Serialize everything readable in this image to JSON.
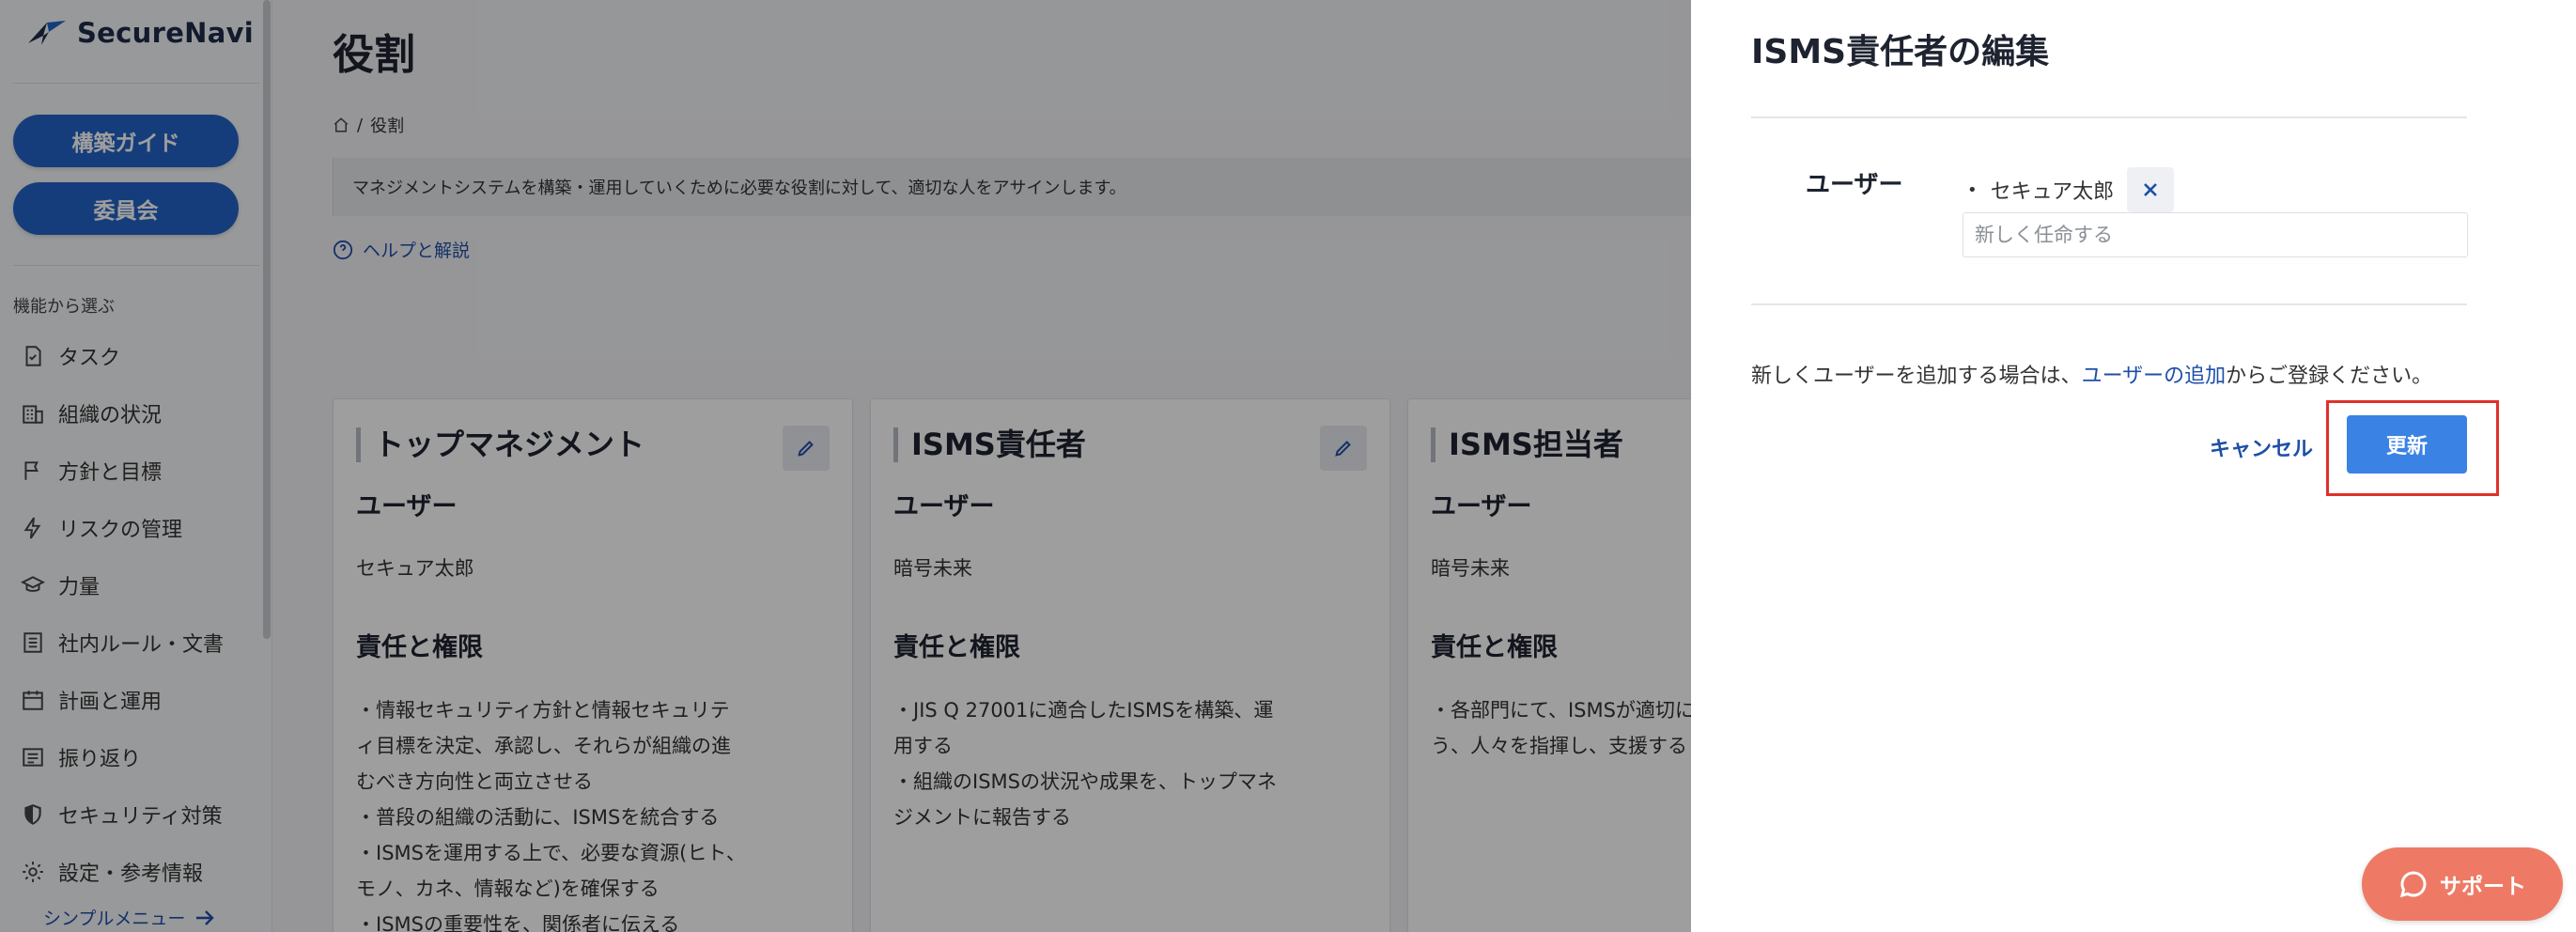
{
  "brand": {
    "name": "SecureNavi"
  },
  "sidebar": {
    "buttons": [
      "構築ガイド",
      "委員会"
    ],
    "section_label": "機能から選ぶ",
    "items": [
      {
        "label": "タスク",
        "icon": "task-icon"
      },
      {
        "label": "組織の状況",
        "icon": "building-icon"
      },
      {
        "label": "方針と目標",
        "icon": "flag-icon"
      },
      {
        "label": "リスクの管理",
        "icon": "bolt-icon"
      },
      {
        "label": "力量",
        "icon": "graduation-cap-icon"
      },
      {
        "label": "社内ルール・文書",
        "icon": "document-icon"
      },
      {
        "label": "計画と運用",
        "icon": "calendar-icon"
      },
      {
        "label": "振り返り",
        "icon": "list-icon"
      },
      {
        "label": "セキュリティ対策",
        "icon": "shield-icon"
      },
      {
        "label": "設定・参考情報",
        "icon": "gear-icon"
      }
    ],
    "simple_menu": "シンプルメニュー"
  },
  "page": {
    "title": "役割",
    "breadcrumb_current": "役割",
    "description": "マネジメントシステムを構築・運用していくために必要な役割に対して、適切な人をアサインします。",
    "help_link": "ヘルプと解説"
  },
  "cards": [
    {
      "title": "トップマネジメント",
      "user_heading": "ユーザー",
      "user": "セキュア太郎",
      "resp_heading": "責任と権限",
      "lines": [
        "・情報セキュリティ方針と情報セキュリテ",
        "ィ目標を決定、承認し、それらが組織の進",
        "むべき方向性と両立させる",
        "・普段の組織の活動に、ISMSを統合する",
        "・ISMSを運用する上で、必要な資源(ヒト、",
        "モノ、カネ、情報など)を確保する",
        "・ISMSの重要性を、関係者に伝える"
      ]
    },
    {
      "title": "ISMS責任者",
      "user_heading": "ユーザー",
      "user": "暗号未来",
      "resp_heading": "責任と権限",
      "lines": [
        "・JIS Q 27001に適合したISMSを構築、運",
        "用する",
        "・組織のISMSの状況や成果を、トップマネ",
        "ジメントに報告する"
      ]
    },
    {
      "title": "ISMS担当者",
      "user_heading": "ユーザー",
      "user": "暗号未来",
      "resp_heading": "責任と権限",
      "lines": [
        "・各部門にて、ISMSが適切に",
        "う、人々を指揮し、支援する"
      ]
    }
  ],
  "drawer": {
    "title": "ISMS責任者の編集",
    "user_label": "ユーザー",
    "assigned_user": "セキュア太郎",
    "input_placeholder": "新しく任命する",
    "note_prefix": "新しくユーザーを追加する場合は、",
    "note_link": "ユーザーの追加",
    "note_suffix": "からご登録ください。",
    "cancel_label": "キャンセル",
    "update_label": "更新"
  },
  "support": {
    "label": "サポート"
  },
  "colors": {
    "primary": "#2563c7",
    "link": "#1f4fa8",
    "support": "#ee7a66",
    "highlight": "#e0302a"
  }
}
